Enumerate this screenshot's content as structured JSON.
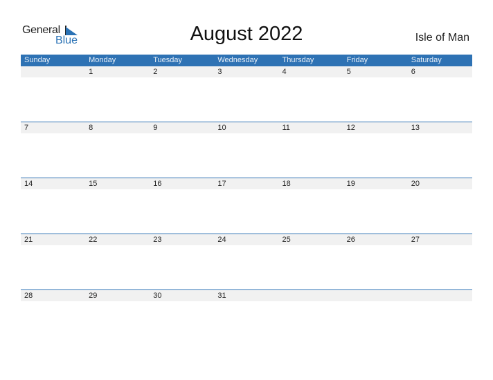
{
  "logo": {
    "general": "General",
    "blue": "Blue"
  },
  "title": "August 2022",
  "country": "Isle of Man",
  "colors": {
    "accent": "#2e72b4",
    "date_strip": "#f1f1f1"
  },
  "days": [
    "Sunday",
    "Monday",
    "Tuesday",
    "Wednesday",
    "Thursday",
    "Friday",
    "Saturday"
  ],
  "weeks": [
    [
      "",
      "1",
      "2",
      "3",
      "4",
      "5",
      "6"
    ],
    [
      "7",
      "8",
      "9",
      "10",
      "11",
      "12",
      "13"
    ],
    [
      "14",
      "15",
      "16",
      "17",
      "18",
      "19",
      "20"
    ],
    [
      "21",
      "22",
      "23",
      "24",
      "25",
      "26",
      "27"
    ],
    [
      "28",
      "29",
      "30",
      "31",
      "",
      "",
      ""
    ]
  ]
}
